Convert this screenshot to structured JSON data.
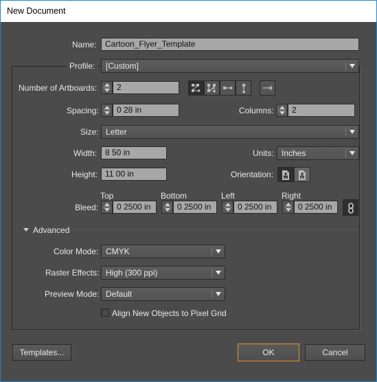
{
  "window": {
    "title": "New Document"
  },
  "name": {
    "label": "Name:",
    "mnemonic": "N",
    "value": "Cartoon_Flyer_Template"
  },
  "profile": {
    "label": "Profile:",
    "mnemonic": "P",
    "value": "[Custom]"
  },
  "artboards": {
    "label": "Number of Artboards:",
    "value": "2",
    "arrangement_icons": [
      "grid-by-row-icon",
      "grid-by-column-icon",
      "arrange-by-row-icon",
      "arrange-by-column-icon"
    ],
    "selected_arrangement": "grid-by-row-icon",
    "layout_direction_icon": "right-to-left-layout-icon"
  },
  "spacing": {
    "label": "Spacing:",
    "value": "0 28 in"
  },
  "columns": {
    "label": "Columns:",
    "value": "2"
  },
  "size": {
    "label": "Size:",
    "value": "Letter"
  },
  "width": {
    "label": "Width:",
    "value": "8 50 in"
  },
  "units": {
    "label": "Units:",
    "value": "Inches"
  },
  "height": {
    "label": "Height:",
    "value": "11 00 in"
  },
  "orientation": {
    "label": "Orientation:",
    "options": [
      "portrait",
      "landscape"
    ],
    "selected": "portrait"
  },
  "bleed": {
    "label": "Bleed:",
    "top": {
      "label": "Top",
      "value": "0 2500 in"
    },
    "bottom": {
      "label": "Bottom",
      "value": "0 2500 in"
    },
    "left": {
      "label": "Left",
      "value": "0 2500 in"
    },
    "right": {
      "label": "Right",
      "value": "0 2500 in"
    },
    "linked": true
  },
  "advanced": {
    "label": "Advanced",
    "expanded": true,
    "color_mode": {
      "label": "Color Mode:",
      "value": "CMYK"
    },
    "raster_effects": {
      "label": "Raster Effects:",
      "value": "High (300 ppi)"
    },
    "preview_mode": {
      "label": "Preview Mode:",
      "value": "Default"
    },
    "align_pixel_grid": {
      "label": "Align New Objects to Pixel Grid",
      "checked": false
    }
  },
  "buttons": {
    "templates": "Templates...",
    "ok": "OK",
    "cancel": "Cancel"
  },
  "colors": {
    "accent_focus": "#e8902a",
    "window_border": "#1e88d8",
    "background": "#4b4b4b"
  }
}
